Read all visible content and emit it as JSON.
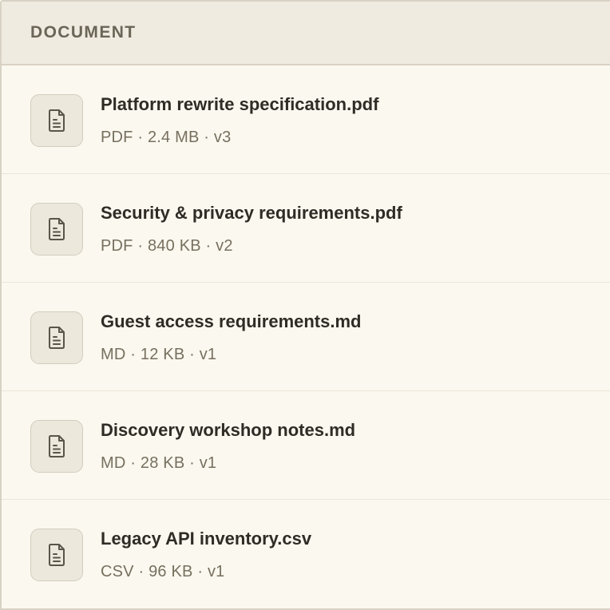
{
  "header": {
    "label": "DOCUMENT"
  },
  "documents": [
    {
      "name": "Platform rewrite specification.pdf",
      "meta": "PDF · 2.4 MB · v3",
      "icon": "document-icon"
    },
    {
      "name": "Security & privacy requirements.pdf",
      "meta": "PDF · 840 KB · v2",
      "icon": "document-icon"
    },
    {
      "name": "Guest access requirements.md",
      "meta": "MD · 12 KB · v1",
      "icon": "document-icon"
    },
    {
      "name": "Discovery workshop notes.md",
      "meta": "MD · 28 KB · v1",
      "icon": "document-icon"
    },
    {
      "name": "Legacy API inventory.csv",
      "meta": "CSV · 96 KB · v1",
      "icon": "document-icon"
    }
  ],
  "colors": {
    "background": "#fbf8ef",
    "header_background": "#efebe0",
    "border": "#d8d2c4",
    "title_text": "#2f2c26",
    "meta_text": "#77705f"
  }
}
